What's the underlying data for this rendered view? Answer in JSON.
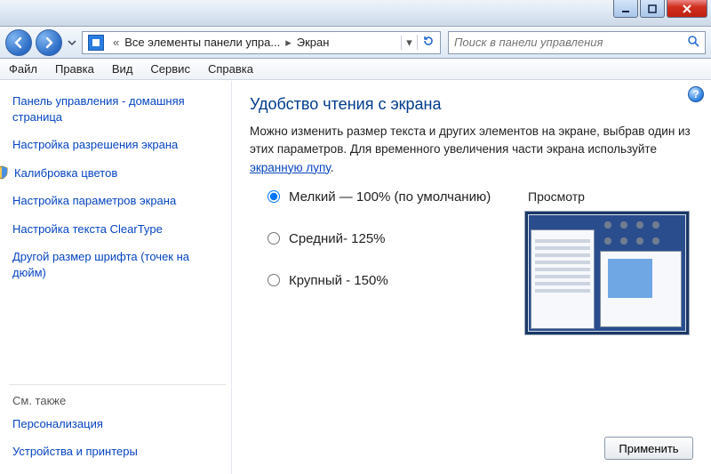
{
  "window_controls": {
    "min": "minimize",
    "max": "maximize",
    "close": "close"
  },
  "breadcrumb": {
    "prefix": "«",
    "seg1": "Все элементы панели упра...",
    "seg2": "Экран"
  },
  "search": {
    "placeholder": "Поиск в панели управления"
  },
  "menubar": [
    "Файл",
    "Правка",
    "Вид",
    "Сервис",
    "Справка"
  ],
  "sidebar": {
    "home_title": "Панель управления - домашняя страница",
    "links": [
      "Настройка разрешения экрана",
      "Калибровка цветов",
      "Настройка параметров экрана",
      "Настройка текста ClearType",
      "Другой размер шрифта (точек на дюйм)"
    ],
    "shield_index": 1,
    "see_also_label": "См. также",
    "see_also": [
      "Персонализация",
      "Устройства и принтеры"
    ]
  },
  "main": {
    "heading": "Удобство чтения с экрана",
    "desc_pre": "Можно изменить размер текста и других элементов на экране, выбрав один из этих параметров. Для временного увеличения части экрана используйте ",
    "desc_link": "экранную лупу",
    "desc_post": ".",
    "options": [
      {
        "label": "Мелкий — 100% (по умолчанию)",
        "checked": true
      },
      {
        "label": "Средний- 125%",
        "checked": false
      },
      {
        "label": "Крупный - 150%",
        "checked": false
      }
    ],
    "preview_label": "Просмотр",
    "apply_label": "Применить"
  },
  "help": "?"
}
